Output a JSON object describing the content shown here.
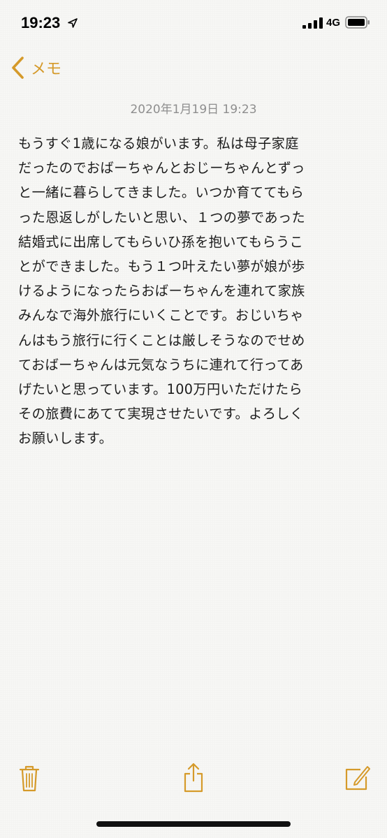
{
  "status_bar": {
    "time": "19:23",
    "network": "4G"
  },
  "nav": {
    "back_label": "メモ"
  },
  "note": {
    "date": "2020年1月19日 19:23",
    "lines": [
      "もうすぐ1歳になる娘がいます。私は母子家庭",
      "だったのでおばーちゃんとおじーちゃんとずっ",
      "と一緒に暮らしてきました。いつか育ててもら",
      "った恩返しがしたいと思い、１つの夢であった",
      "結婚式に出席してもらいひ孫を抱いてもらうこ",
      "とができました。もう１つ叶えたい夢が娘が歩",
      "けるようになったらおばーちゃんを連れて家族",
      "みんなで海外旅行にいくことです。おじいちゃ",
      "んはもう旅行に行くことは厳しそうなのでせめ",
      "ておばーちゃんは元気なうちに連れて行ってあ",
      "げたいと思っています。100万円いただけたら",
      "その旅費にあてて実現させたいです。よろしく",
      "お願いします。"
    ]
  },
  "colors": {
    "accent": "#d59a2a",
    "background": "#f7f7f5",
    "date_text": "#8e8e8e"
  },
  "icons": {
    "back": "chevron-left-icon",
    "trash": "trash-icon",
    "share": "share-icon",
    "compose": "compose-icon"
  }
}
